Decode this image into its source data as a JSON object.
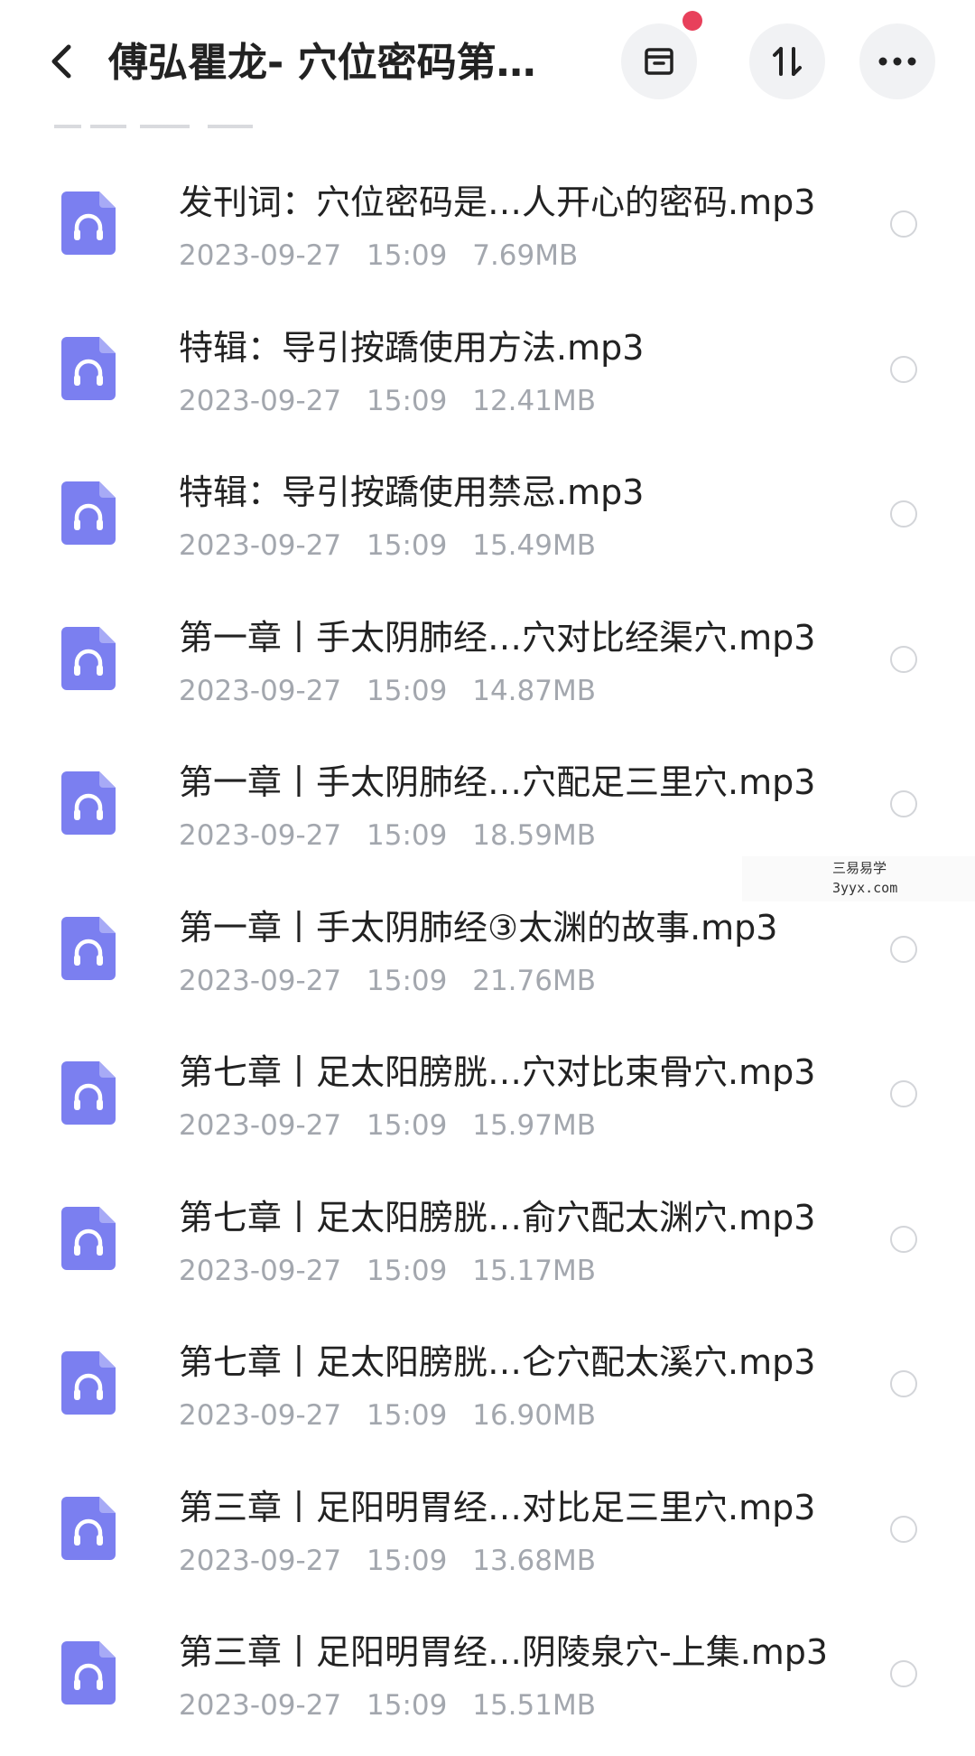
{
  "header": {
    "title": "傅弘瞿龙- 穴位密码第…",
    "back_icon": "chevron-left-icon",
    "actions": [
      {
        "name": "archive",
        "icon": "archive-box-icon"
      },
      {
        "name": "sort",
        "icon": "sort-arrows-icon"
      },
      {
        "name": "more",
        "icon": "more-dots-icon"
      }
    ],
    "notification_color": "#e8405b"
  },
  "files": [
    {
      "name": "发刊词：穴位密码是…人开心的密码.mp3",
      "date": "2023-09-27",
      "time": "15:09",
      "size": "7.69MB"
    },
    {
      "name": "特辑：导引按蹻使用方法.mp3",
      "date": "2023-09-27",
      "time": "15:09",
      "size": "12.41MB"
    },
    {
      "name": "特辑：导引按蹻使用禁忌.mp3",
      "date": "2023-09-27",
      "time": "15:09",
      "size": "15.49MB"
    },
    {
      "name": "第一章丨手太阴肺经…穴对比经渠穴.mp3",
      "date": "2023-09-27",
      "time": "15:09",
      "size": "14.87MB"
    },
    {
      "name": "第一章丨手太阴肺经…穴配足三里穴.mp3",
      "date": "2023-09-27",
      "time": "15:09",
      "size": "18.59MB"
    },
    {
      "name": "第一章丨手太阴肺经③太渊的故事.mp3",
      "date": "2023-09-27",
      "time": "15:09",
      "size": "21.76MB"
    },
    {
      "name": "第七章丨足太阳膀胱…穴对比束骨穴.mp3",
      "date": "2023-09-27",
      "time": "15:09",
      "size": "15.97MB"
    },
    {
      "name": "第七章丨足太阳膀胱…俞穴配太渊穴.mp3",
      "date": "2023-09-27",
      "time": "15:09",
      "size": "15.17MB"
    },
    {
      "name": "第七章丨足太阳膀胱…仑穴配太溪穴.mp3",
      "date": "2023-09-27",
      "time": "15:09",
      "size": "16.90MB"
    },
    {
      "name": "第三章丨足阳明胃经…对比足三里穴.mp3",
      "date": "2023-09-27",
      "time": "15:09",
      "size": "13.68MB"
    },
    {
      "name": "第三章丨足阳明胃经…阴陵泉穴-上集.mp3",
      "date": "2023-09-27",
      "time": "15:09",
      "size": "15.51MB"
    }
  ],
  "file_icon": "audio-headphones-icon",
  "colors": {
    "icon_accent": "#7b7ff0",
    "meta_text": "#a3a7ae",
    "circle_border": "#d3d5d9"
  },
  "watermark": {
    "line1": "三易易学",
    "line2": "3yyx.com"
  }
}
